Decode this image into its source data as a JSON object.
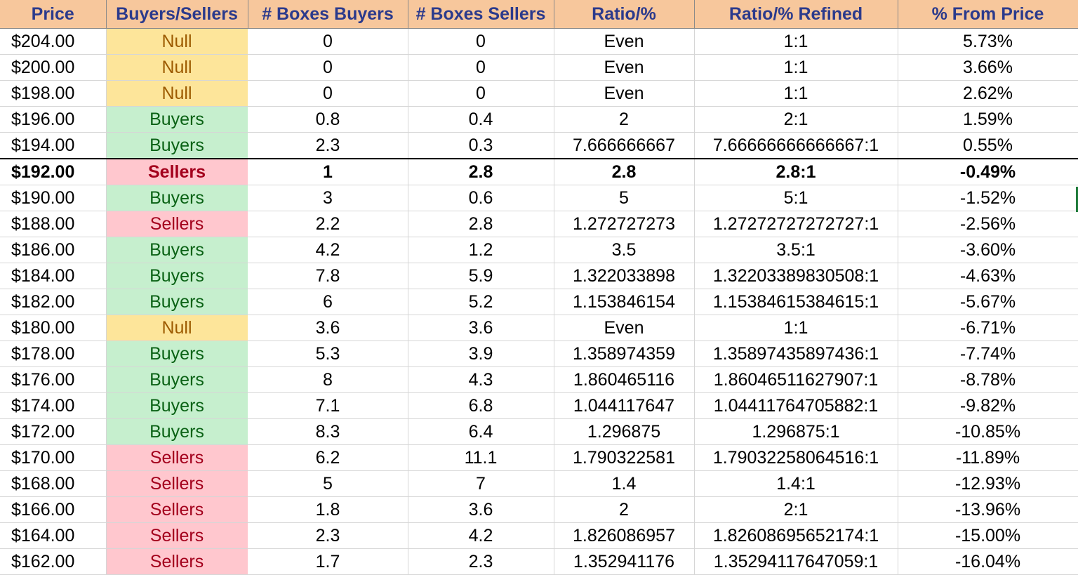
{
  "columns": [
    "Price",
    "Buyers/Sellers",
    "# Boxes Buyers",
    "# Boxes Sellers",
    "Ratio/%",
    "Ratio/% Refined",
    "% From Price"
  ],
  "status_colors": {
    "Null": {
      "bg": "#fde59a",
      "fg": "#9c5a00"
    },
    "Buyers": {
      "bg": "#c6efce",
      "fg": "#0a6215"
    },
    "Sellers": {
      "bg": "#ffc7ce",
      "fg": "#a3001c"
    }
  },
  "current_price": "$192.00",
  "rows": [
    [
      "$204.00",
      "Null",
      "0",
      "0",
      "Even",
      "1:1",
      "5.73%"
    ],
    [
      "$200.00",
      "Null",
      "0",
      "0",
      "Even",
      "1:1",
      "3.66%"
    ],
    [
      "$198.00",
      "Null",
      "0",
      "0",
      "Even",
      "1:1",
      "2.62%"
    ],
    [
      "$196.00",
      "Buyers",
      "0.8",
      "0.4",
      "2",
      "2:1",
      "1.59%"
    ],
    [
      "$194.00",
      "Buyers",
      "2.3",
      "0.3",
      "7.666666667",
      "7.66666666666667:1",
      "0.55%"
    ],
    [
      "$192.00",
      "Sellers",
      "1",
      "2.8",
      "2.8",
      "2.8:1",
      "-0.49%"
    ],
    [
      "$190.00",
      "Buyers",
      "3",
      "0.6",
      "5",
      "5:1",
      "-1.52%"
    ],
    [
      "$188.00",
      "Sellers",
      "2.2",
      "2.8",
      "1.272727273",
      "1.27272727272727:1",
      "-2.56%"
    ],
    [
      "$186.00",
      "Buyers",
      "4.2",
      "1.2",
      "3.5",
      "3.5:1",
      "-3.60%"
    ],
    [
      "$184.00",
      "Buyers",
      "7.8",
      "5.9",
      "1.322033898",
      "1.32203389830508:1",
      "-4.63%"
    ],
    [
      "$182.00",
      "Buyers",
      "6",
      "5.2",
      "1.153846154",
      "1.15384615384615:1",
      "-5.67%"
    ],
    [
      "$180.00",
      "Null",
      "3.6",
      "3.6",
      "Even",
      "1:1",
      "-6.71%"
    ],
    [
      "$178.00",
      "Buyers",
      "5.3",
      "3.9",
      "1.358974359",
      "1.35897435897436:1",
      "-7.74%"
    ],
    [
      "$176.00",
      "Buyers",
      "8",
      "4.3",
      "1.860465116",
      "1.86046511627907:1",
      "-8.78%"
    ],
    [
      "$174.00",
      "Buyers",
      "7.1",
      "6.8",
      "1.044117647",
      "1.04411764705882:1",
      "-9.82%"
    ],
    [
      "$172.00",
      "Buyers",
      "8.3",
      "6.4",
      "1.296875",
      "1.296875:1",
      "-10.85%"
    ],
    [
      "$170.00",
      "Sellers",
      "6.2",
      "11.1",
      "1.790322581",
      "1.79032258064516:1",
      "-11.89%"
    ],
    [
      "$168.00",
      "Sellers",
      "5",
      "7",
      "1.4",
      "1.4:1",
      "-12.93%"
    ],
    [
      "$166.00",
      "Sellers",
      "1.8",
      "3.6",
      "2",
      "2:1",
      "-13.96%"
    ],
    [
      "$164.00",
      "Sellers",
      "2.3",
      "4.2",
      "1.826086957",
      "1.82608695652174:1",
      "-15.00%"
    ],
    [
      "$162.00",
      "Sellers",
      "1.7",
      "2.3",
      "1.352941176",
      "1.35294117647059:1",
      "-16.04%"
    ]
  ]
}
